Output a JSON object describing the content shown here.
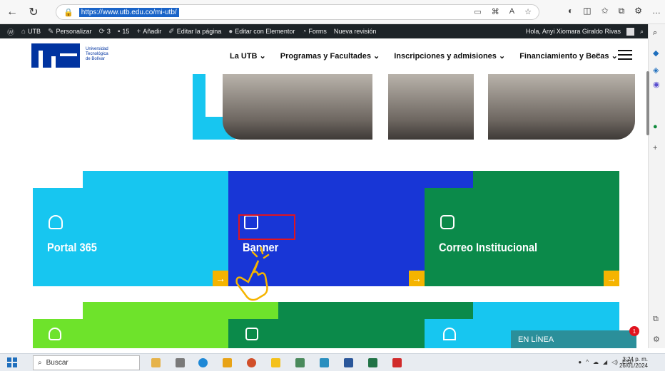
{
  "browser": {
    "url": "https://www.utb.edu.co/mi-utb/"
  },
  "wp_admin": {
    "site": "UTB",
    "customize": "Personalizar",
    "updates": "3",
    "comments": "15",
    "add_new": "Añadir",
    "edit_page": "Editar la página",
    "edit_elementor": "Editar con Elementor",
    "forms": "Forms",
    "new_revision": "Nueva revisión",
    "greeting": "Hola, Anyi Xiomara Giraldo Rivas"
  },
  "site": {
    "logo_text": [
      "Universidad",
      "Tecnológica",
      "de Bolívar"
    ],
    "nav": [
      "La UTB ⌄",
      "Programas y Facultades ⌄",
      "Inscripciones y admisiones ⌄",
      "Financiamiento y Becas ⌄"
    ]
  },
  "tiles": {
    "portal": "Portal 365",
    "banner": "Banner",
    "correo": "Correo Institucional",
    "arrow": "→"
  },
  "chat": {
    "label": "EN LÍNEA",
    "badge": "1"
  },
  "taskbar": {
    "search": "Buscar",
    "language": "ESP",
    "time": "3:24 p. m.",
    "date": "26/01/2024"
  },
  "colors": {
    "utb_blue": "#0033a0",
    "cyan": "#17c6f0",
    "royal": "#1836d6",
    "green": "#0b8a4a",
    "lime": "#6ee32b",
    "accent": "#f5b400",
    "highlight": "#e0141f"
  }
}
